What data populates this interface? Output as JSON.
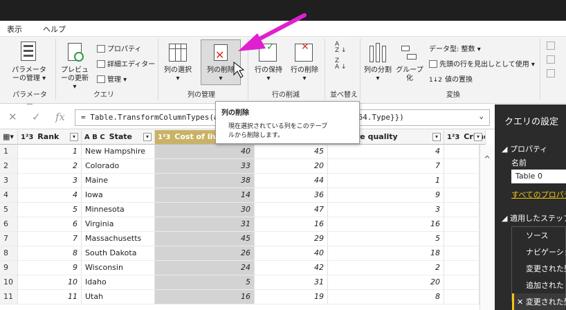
{
  "menu": {
    "view": "表示",
    "help": "ヘルプ"
  },
  "ribbon": {
    "params_manage": "パラメーターの管理",
    "params_group": "パラメーター",
    "preview_refresh": "プレビューの更新",
    "properties": "プロパティ",
    "advanced_editor": "詳細エディター",
    "manage": "管理",
    "query_group": "クエリ",
    "choose_columns": "列の選択",
    "remove_columns": "列の削除",
    "manage_columns_group": "列の管理",
    "keep_rows": "行の保持",
    "remove_rows": "行の削除",
    "reduce_rows_group": "行の削減",
    "sort_group": "並べ替え",
    "split_column": "列の分割",
    "group_by": "グループ化",
    "data_type": "データ型: 整数",
    "first_row_header": "先頭の行を見出しとして使用",
    "replace_values": "値の置換",
    "transform_group": "変換"
  },
  "formula": {
    "text": "= Table.TransformColumnTypes(#",
    "text_end": "t64.Type}})"
  },
  "tooltip": {
    "title": "列の削除",
    "body_line1": "現在選択されている列をこのテーブ",
    "body_line2": "ルから削除します。"
  },
  "columns": [
    {
      "type": "1²3",
      "name": "Rank"
    },
    {
      "type": "A B C",
      "name": "State"
    },
    {
      "type": "1²3",
      "name": "Cost of living"
    },
    {
      "type": "",
      "name": ""
    },
    {
      "type": "",
      "name": "th care quality"
    },
    {
      "type": "1²3",
      "name": "Crime"
    }
  ],
  "rows": [
    {
      "row": "1",
      "rank": "1",
      "state": "New Hampshire",
      "cost": "40",
      "c4": "45",
      "health": "4"
    },
    {
      "row": "2",
      "rank": "2",
      "state": "Colorado",
      "cost": "33",
      "c4": "20",
      "health": "7"
    },
    {
      "row": "3",
      "rank": "3",
      "state": "Maine",
      "cost": "38",
      "c4": "44",
      "health": "1"
    },
    {
      "row": "4",
      "rank": "4",
      "state": "Iowa",
      "cost": "14",
      "c4": "36",
      "health": "9"
    },
    {
      "row": "5",
      "rank": "5",
      "state": "Minnesota",
      "cost": "30",
      "c4": "47",
      "health": "3"
    },
    {
      "row": "6",
      "rank": "6",
      "state": "Virginia",
      "cost": "31",
      "c4": "16",
      "health": "16"
    },
    {
      "row": "7",
      "rank": "7",
      "state": "Massachusetts",
      "cost": "45",
      "c4": "29",
      "health": "5"
    },
    {
      "row": "8",
      "rank": "8",
      "state": "South Dakota",
      "cost": "26",
      "c4": "40",
      "health": "18"
    },
    {
      "row": "9",
      "rank": "9",
      "state": "Wisconsin",
      "cost": "24",
      "c4": "42",
      "health": "2"
    },
    {
      "row": "10",
      "rank": "10",
      "state": "Idaho",
      "cost": "5",
      "c4": "31",
      "health": "20"
    },
    {
      "row": "11",
      "rank": "11",
      "state": "Utah",
      "cost": "16",
      "c4": "19",
      "health": "8"
    }
  ],
  "settings": {
    "title": "クエリの設定",
    "properties": "プロパティ",
    "name_label": "名前",
    "name_value": "Table 0",
    "all_props": "すべてのプロパティ",
    "applied_steps": "適用したステップ",
    "steps": [
      "ソース",
      "ナビゲーション",
      "変更された型",
      "追加された",
      "変更された型"
    ]
  }
}
